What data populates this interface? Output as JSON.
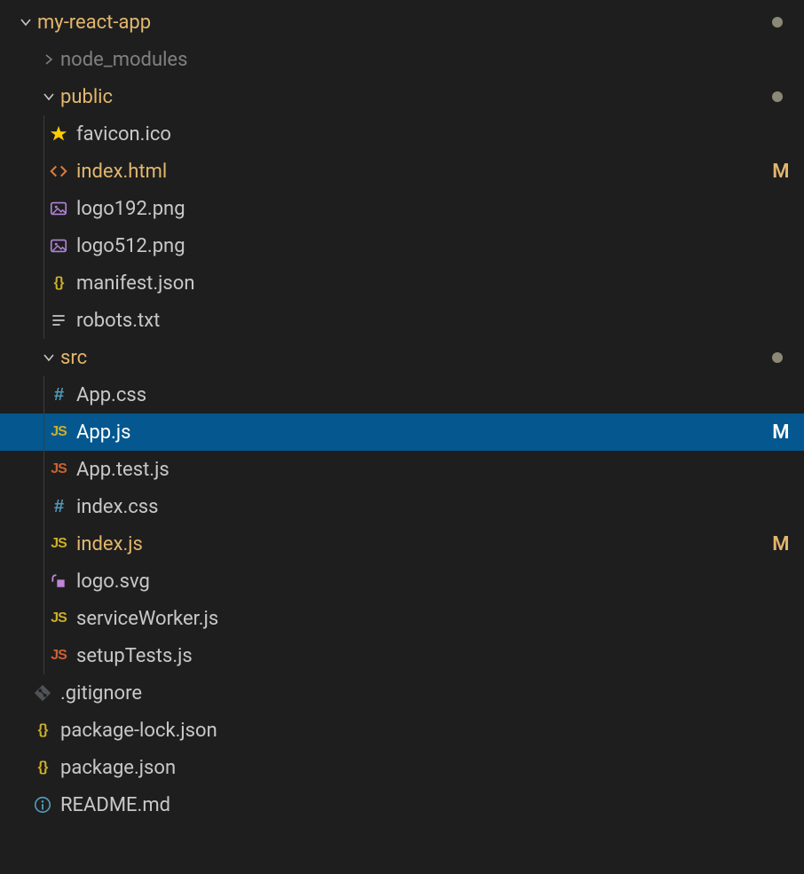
{
  "tree": {
    "root": {
      "name": "my-react-app",
      "modified": true
    },
    "node_modules": "node_modules",
    "public": {
      "name": "public",
      "modified": true
    },
    "public_files": {
      "favicon": "favicon.ico",
      "indexhtml": {
        "name": "index.html",
        "status": "M"
      },
      "logo192": "logo192.png",
      "logo512": "logo512.png",
      "manifest": "manifest.json",
      "robots": "robots.txt"
    },
    "src": {
      "name": "src",
      "modified": true
    },
    "src_files": {
      "appcss": "App.css",
      "appjs": {
        "name": "App.js",
        "status": "M"
      },
      "apptest": "App.test.js",
      "indexcss": "index.css",
      "indexjs": {
        "name": "index.js",
        "status": "M"
      },
      "logosvg": "logo.svg",
      "serviceworker": "serviceWorker.js",
      "setuptests": "setupTests.js"
    },
    "root_files": {
      "gitignore": ".gitignore",
      "packagelock": "package-lock.json",
      "packagejson": "package.json",
      "readme": "README.md"
    }
  }
}
